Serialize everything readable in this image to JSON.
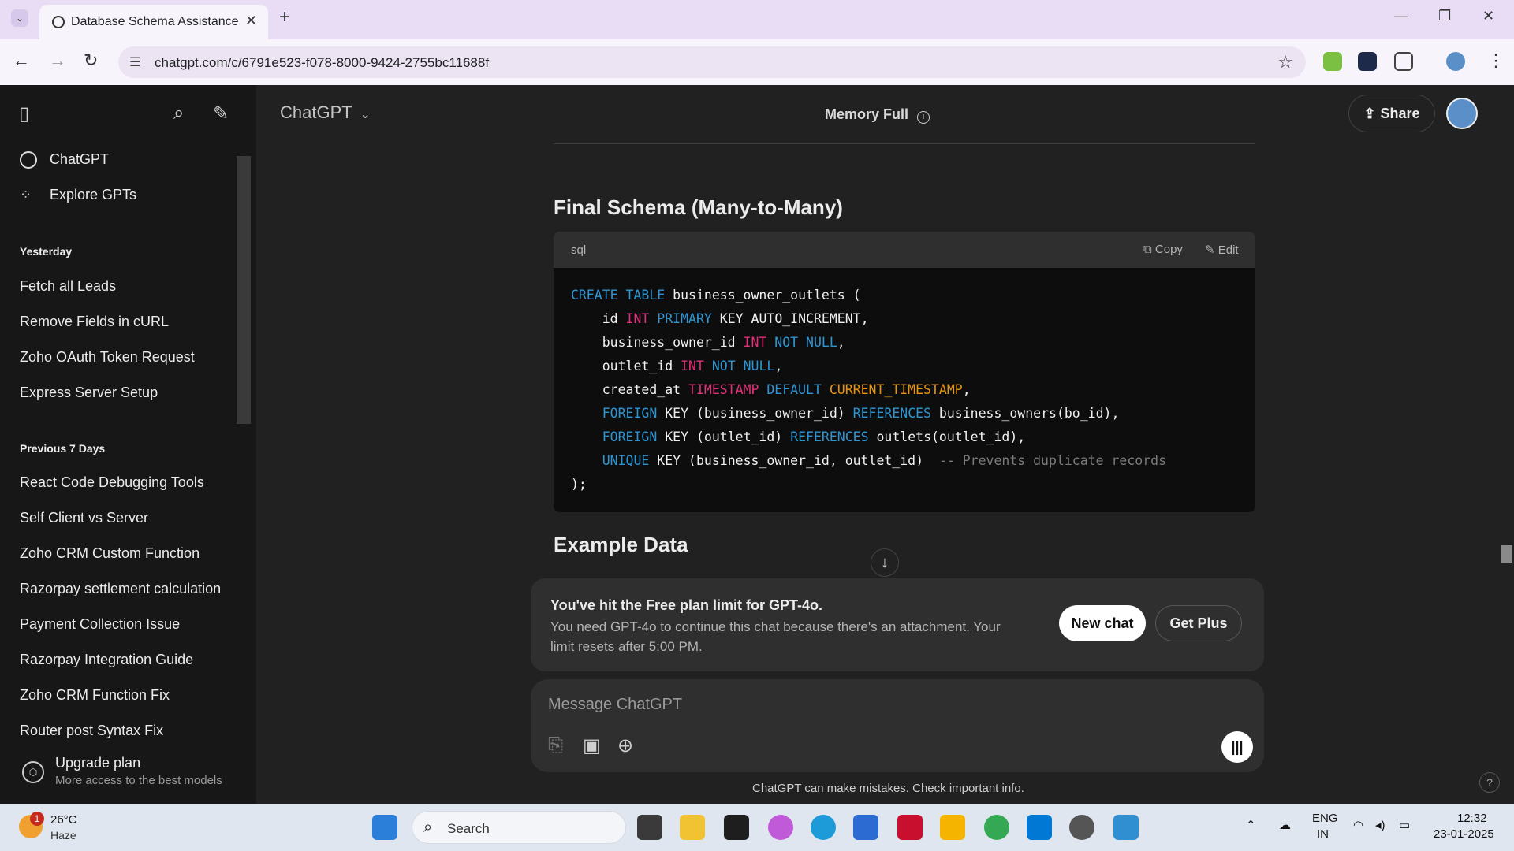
{
  "browser": {
    "tab_title": "Database Schema Assistance",
    "url": "chatgpt.com/c/6791e523-f078-8000-9424-2755bc11688f"
  },
  "sidebar": {
    "items": [
      {
        "label": "ChatGPT",
        "icon": "openai-logo-icon"
      },
      {
        "label": "Explore GPTs",
        "icon": "grid-icon"
      }
    ],
    "groups": [
      {
        "heading": "Yesterday",
        "chats": [
          "Fetch all Leads",
          "Remove Fields in cURL",
          "Zoho OAuth Token Request",
          "Express Server Setup"
        ]
      },
      {
        "heading": "Previous 7 Days",
        "chats": [
          "React Code Debugging Tools",
          "Self Client vs Server",
          "Zoho CRM Custom Function",
          "Razorpay settlement calculation",
          "Payment Collection Issue",
          "Razorpay Integration Guide",
          "Zoho CRM Function Fix",
          "Router post Syntax Fix"
        ]
      }
    ],
    "upgrade_title": "Upgrade plan",
    "upgrade_subtitle": "More access to the best models"
  },
  "header": {
    "model": "ChatGPT",
    "memory": "Memory Full",
    "share": "Share"
  },
  "content": {
    "section_title": "Final Schema (Many-to-Many)",
    "code_lang": "sql",
    "copy_label": "Copy",
    "edit_label": "Edit",
    "code_lines": [
      "CREATE TABLE business_owner_outlets (",
      "    id INT PRIMARY KEY AUTO_INCREMENT,",
      "    business_owner_id INT NOT NULL,",
      "    outlet_id INT NOT NULL,",
      "    created_at TIMESTAMP DEFAULT CURRENT_TIMESTAMP,",
      "    FOREIGN KEY (business_owner_id) REFERENCES business_owners(bo_id),",
      "    FOREIGN KEY (outlet_id) REFERENCES outlets(outlet_id),",
      "    UNIQUE KEY (business_owner_id, outlet_id)  -- Prevents duplicate records",
      ");"
    ],
    "next_section_title": "Example Data"
  },
  "limit_banner": {
    "title": "You've hit the Free plan limit for GPT-4o.",
    "body": "You need GPT-4o to continue this chat because there's an attachment. Your limit resets after 5:00 PM.",
    "new_chat": "New chat",
    "get_plus": "Get Plus"
  },
  "composer": {
    "placeholder": "Message ChatGPT",
    "disclaimer": "ChatGPT can make mistakes. Check important info."
  },
  "taskbar": {
    "temperature": "26°C",
    "condition": "Haze",
    "weather_badge": "1",
    "search_label": "Search",
    "language": "ENG",
    "region": "IN",
    "time": "12:32",
    "date": "23-01-2025"
  },
  "colors": {
    "keyword": "#2e95d3",
    "type": "#df3079",
    "function": "#e9950c",
    "comment": "#7a7a7a"
  }
}
